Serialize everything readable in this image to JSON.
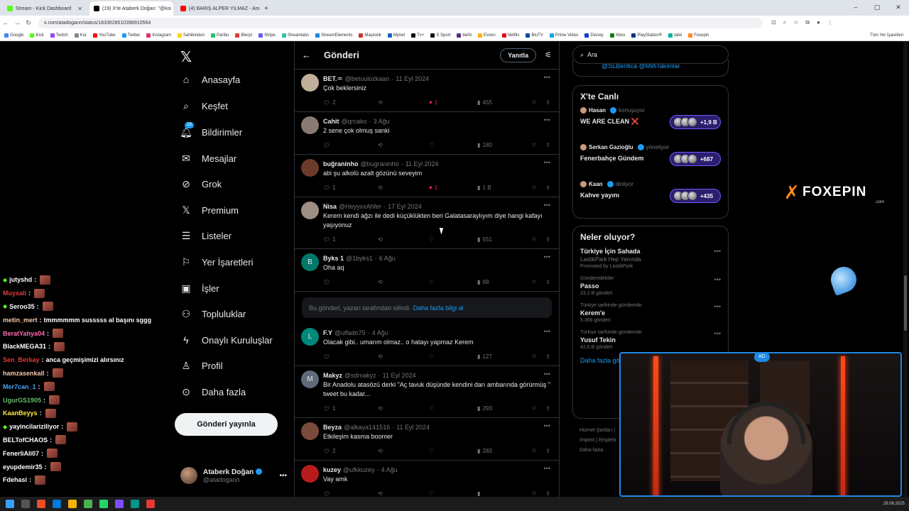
{
  "browser": {
    "tabs": [
      {
        "title": "Stream - Kick Dashboard",
        "color": "#53fc18",
        "active": false
      },
      {
        "title": "(19) X'te Ataberk Doğan: \"@koi",
        "color": "#000000",
        "active": true
      },
      {
        "title": "(4) BARIŞ ALPER YILMAZ - Ama",
        "color": "#ff0000",
        "active": false
      }
    ],
    "url": "x.com/atadogann/status/1833628510398910564",
    "bookmarks": [
      {
        "label": "Google",
        "color": "#4285f4"
      },
      {
        "label": "Kick",
        "color": "#53fc18"
      },
      {
        "label": "Twitch",
        "color": "#9146ff"
      },
      {
        "label": "Kur",
        "color": "#888888"
      },
      {
        "label": "YouTube",
        "color": "#ff0000"
      },
      {
        "label": "Twitter",
        "color": "#1d9bf0"
      },
      {
        "label": "Instagram",
        "color": "#e1306c"
      },
      {
        "label": "Sahibinden",
        "color": "#ffd400"
      },
      {
        "label": "Paribu",
        "color": "#25c16f"
      },
      {
        "label": "Bterpi",
        "color": "#e53935"
      },
      {
        "label": "Stripe",
        "color": "#635bff"
      },
      {
        "label": "Streamlabs",
        "color": "#31c3a2"
      },
      {
        "label": "StreamElements",
        "color": "#1e88e5"
      },
      {
        "label": "Maçkolik",
        "color": "#d32f2f"
      },
      {
        "label": "Mynet",
        "color": "#1565c0"
      },
      {
        "label": "Tv+",
        "color": "#111111"
      },
      {
        "label": "S Sport",
        "color": "#111111"
      },
      {
        "label": "beIN",
        "color": "#5e2a84"
      },
      {
        "label": "Exxen",
        "color": "#ffb300"
      },
      {
        "label": "Netflix",
        "color": "#e50914"
      },
      {
        "label": "BluTV",
        "color": "#0d47a1"
      },
      {
        "label": "Prime Video",
        "color": "#00a8e1"
      },
      {
        "label": "Disney",
        "color": "#113ccf"
      },
      {
        "label": "Xbox",
        "color": "#107c10"
      },
      {
        "label": "PlayStation®",
        "color": "#003087"
      },
      {
        "label": "tabii",
        "color": "#00b3a4"
      },
      {
        "label": "Foxepin",
        "color": "#ff8a1f"
      }
    ],
    "all_bookmarks": "Tüm Yer İşaretleri"
  },
  "chat": [
    {
      "user": "jutyshd",
      "color": "#ffffff",
      "msg": "",
      "vip": true
    },
    {
      "user": "Muysali",
      "color": "#e53935",
      "msg": "",
      "vip": false
    },
    {
      "user": "Seroo35",
      "color": "#ffffff",
      "msg": "",
      "vip": true
    },
    {
      "user": "metin_mert",
      "color": "#f7c9a9",
      "msg": "tmmmmmm susssss al başını sggg",
      "vip": false
    },
    {
      "user": "BeratYahya04",
      "color": "#ff69b4",
      "msg": "",
      "vip": false
    },
    {
      "user": "BlackMEGA31",
      "color": "#ffffff",
      "msg": "",
      "vip": false
    },
    {
      "user": "Sen_Berkay",
      "color": "#e53935",
      "msg": "anca geçmişimizi alırsınız",
      "vip": false
    },
    {
      "user": "hamzasenkall",
      "color": "#f7c9a9",
      "msg": "",
      "vip": false
    },
    {
      "user": "Mer7can_1",
      "color": "#42a5f5",
      "msg": "",
      "vip": false
    },
    {
      "user": "UgurGS1905",
      "color": "#66bb6a",
      "msg": "",
      "vip": false
    },
    {
      "user": "KaanBeyys",
      "color": "#ffeb3b",
      "msg": "",
      "vip": false
    },
    {
      "user": "yayincilariziliyor",
      "color": "#ffffff",
      "msg": "",
      "vip": true
    },
    {
      "user": "BELTofCHAOS",
      "color": "#ffffff",
      "msg": "",
      "vip": false
    },
    {
      "user": "FenerliAli07",
      "color": "#ffffff",
      "msg": "",
      "vip": false
    },
    {
      "user": "eyupdemir35",
      "color": "#ffffff",
      "msg": "",
      "vip": false
    },
    {
      "user": "Fdehasi",
      "color": "#ffffff",
      "msg": "",
      "vip": false
    }
  ],
  "nav": {
    "home": "Anasayfa",
    "explore": "Keşfet",
    "notifications": "Bildirimler",
    "notif_count": "19",
    "messages": "Mesajlar",
    "grok": "Grok",
    "premium": "Premium",
    "lists": "Listeler",
    "bookmarks": "Yer İşaretleri",
    "jobs": "İşler",
    "communities": "Topluluklar",
    "verified_orgs": "Onaylı Kuruluşlar",
    "profile": "Profil",
    "more": "Daha fazla",
    "post_button": "Gönderi yayınla"
  },
  "account": {
    "name": "Ataberk Doğan",
    "handle": "@atadogann"
  },
  "main": {
    "title": "Gönderi",
    "reply_button": "Yanıtla",
    "tweets": [
      {
        "name": "BET.♒",
        "handle": "@betuulozkaan",
        "date": "11 Eyl 2024",
        "text": "Çok beklersiniz",
        "replies": "2",
        "retweets": "",
        "likes": "1",
        "liked": true,
        "views": "455",
        "avatar_color": "#bfae9a"
      },
      {
        "name": "Cahit",
        "handle": "@qrcako",
        "date": "3 Ağu",
        "text": "2 sene çok olmuş sanki",
        "replies": "",
        "retweets": "",
        "likes": "",
        "liked": false,
        "views": "180",
        "avatar_color": "#8a7a72"
      },
      {
        "name": "buğraninho",
        "handle": "@bugraninho",
        "date": "11 Eyl 2024",
        "text": "abi şu alkolü azalt gözünü seveyim",
        "replies": "1",
        "retweets": "",
        "likes": "1",
        "liked": true,
        "views": "1 B",
        "avatar_color": "#6b3a2a"
      },
      {
        "name": "Nisa",
        "handle": "@HeyyxxAhfer",
        "date": "17 Eyl 2024",
        "text": "Kerem kendi ağzı ile dedi küçüklükten beri Galatasaraylıyım diye hangi kafayı yaşıyonuz",
        "replies": "1",
        "retweets": "",
        "likes": "",
        "liked": false,
        "views": "551",
        "avatar_color": "#9e8e84"
      },
      {
        "name": "Byks 1",
        "handle": "@1byks1",
        "date": "6 Ağu",
        "text": "Oha aq",
        "replies": "",
        "retweets": "",
        "likes": "",
        "liked": false,
        "views": "69",
        "avatar_color": "#00796b",
        "initial": "B"
      },
      {
        "name": "F.Y",
        "handle": "@ulfado75",
        "date": "4 Ağu",
        "text": "Olacak gibi.. umarım olmaz.. o hatayı yapmaz Kerem",
        "replies": "",
        "retweets": "",
        "likes": "",
        "liked": false,
        "views": "127",
        "avatar_color": "#00897b",
        "initial": "L"
      },
      {
        "name": "Makyz",
        "handle": "@sdmakyz",
        "date": "11 Eyl 2024",
        "text": "Bir Anadolu atasözü derki \"Aç tavuk düşünde kendini darı ambarında görürmüş \" tweet bu kadar...",
        "replies": "1",
        "retweets": "",
        "likes": "",
        "liked": false,
        "views": "293",
        "avatar_color": "#5f6b7a",
        "initial": "M"
      },
      {
        "name": "Beyza",
        "handle": "@alkaya141516",
        "date": "11 Eyl 2024",
        "text": "Etkileşim kasma boomer",
        "replies": "2",
        "retweets": "",
        "likes": "",
        "liked": false,
        "views": "283",
        "avatar_color": "#7a4a3a"
      },
      {
        "name": "kuzey",
        "handle": "@ufkkuzey",
        "date": "4 Ağu",
        "text": "Vay amk",
        "replies": "",
        "retweets": "",
        "likes": "",
        "liked": false,
        "views": "",
        "avatar_color": "#b71c1c"
      }
    ],
    "deleted_notice": "Bu gönderi, yazarı tarafından silindi.",
    "deleted_link": "Daha fazla bilgi al"
  },
  "right": {
    "search_placeholder": "Ara",
    "mentions_text": "@SLBenfica @MilliTakimlar",
    "live_title": "X'te Canlı",
    "live": [
      {
        "host": "Hasan",
        "role": "konuşuyor",
        "title": "WE ARE CLEAN ❌",
        "count": "+1,9 B"
      },
      {
        "host": "Serkan Gazioğlu",
        "role": "yönetiyor",
        "title": "Fenerbahçe Gündem",
        "count": "+687"
      },
      {
        "host": "Kaan",
        "role": "dinliyor",
        "title": "Kahve yayını",
        "count": "+435"
      }
    ],
    "trends_title": "Neler oluyor?",
    "trends": [
      {
        "context": "",
        "title": "Türkiye İçin Sahada",
        "sub": "LastikPark Hep Yanında",
        "count": "Promoted by LastikPark"
      },
      {
        "context": "Gündemdekiler",
        "title": "Passo",
        "sub": "",
        "count": "23,2 B gönderi"
      },
      {
        "context": "Türkiye tarihinde gündemde",
        "title": "Kerem'e",
        "sub": "",
        "count": "5.366 gönderi"
      },
      {
        "context": "Türkiye tarihinde gündemde",
        "title": "Yusuf Tekin",
        "sub": "",
        "count": "42,6 B gönderi"
      }
    ],
    "show_more": "Daha fazla gö",
    "footer": [
      "Hizmet Şartları |",
      "Imprint | Erişilebi",
      "Daha fazla ·"
    ]
  },
  "overlay": {
    "brand": "FOXEPIN",
    "brand_domain": ".com",
    "cam_logo": "AD"
  },
  "taskbar": {
    "date": "29.08.2025"
  }
}
